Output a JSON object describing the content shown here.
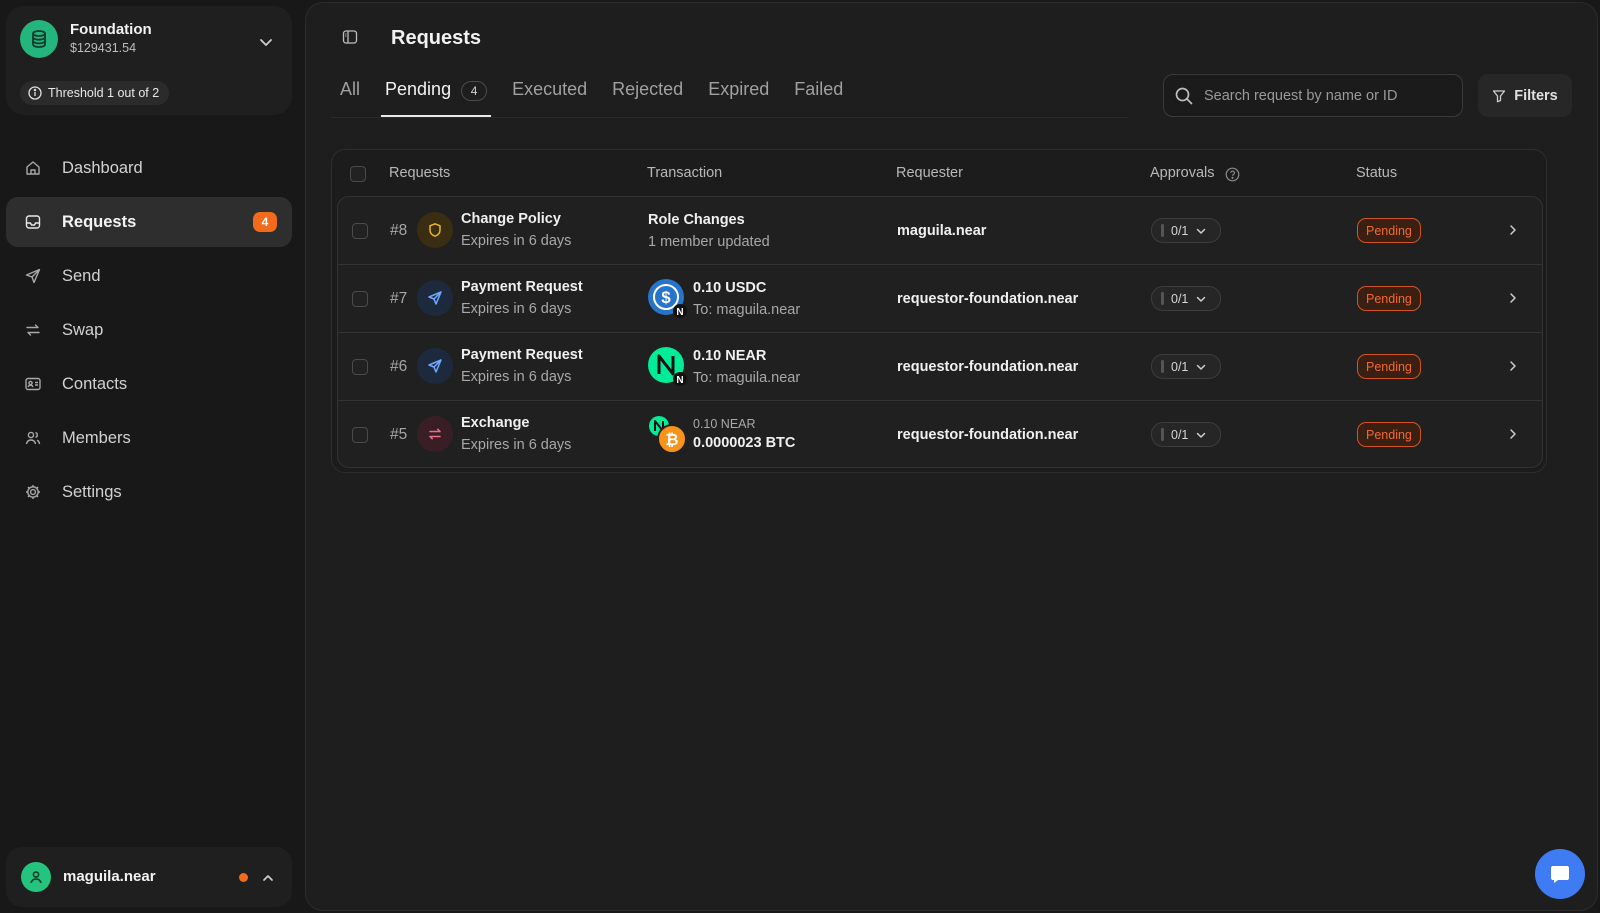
{
  "workspace": {
    "name": "Foundation",
    "balance": "$129431.54",
    "threshold": "Threshold 1 out of 2"
  },
  "nav": {
    "items": [
      {
        "label": "Dashboard",
        "icon": "home-icon"
      },
      {
        "label": "Requests",
        "icon": "inbox-icon",
        "badge": "4",
        "active": true
      },
      {
        "label": "Send",
        "icon": "send-icon"
      },
      {
        "label": "Swap",
        "icon": "swap-icon"
      },
      {
        "label": "Contacts",
        "icon": "contacts-icon"
      },
      {
        "label": "Members",
        "icon": "members-icon"
      },
      {
        "label": "Settings",
        "icon": "gear-icon"
      }
    ]
  },
  "user": {
    "name": "maguila.near"
  },
  "header": {
    "title": "Requests"
  },
  "tabs": [
    {
      "label": "All"
    },
    {
      "label": "Pending",
      "count": "4",
      "active": true
    },
    {
      "label": "Executed"
    },
    {
      "label": "Rejected"
    },
    {
      "label": "Expired"
    },
    {
      "label": "Failed"
    }
  ],
  "search": {
    "placeholder": "Search request by name or ID"
  },
  "filters": {
    "label": "Filters"
  },
  "table": {
    "columns": [
      "Requests",
      "Transaction",
      "Requester",
      "Approvals",
      "Status"
    ],
    "rows": [
      {
        "id": "#8",
        "title": "Change Policy",
        "expires": "Expires in 6 days",
        "type_icon": "shield-icon",
        "tx_title": "Role Changes",
        "tx_sub": "1 member updated",
        "requester": "maguila.near",
        "approvals": "0/1",
        "status": "Pending"
      },
      {
        "id": "#7",
        "title": "Payment Request",
        "expires": "Expires in 6 days",
        "type_icon": "send-icon",
        "token": "usdc-icon",
        "amount": "0.10 USDC",
        "to": "To: maguila.near",
        "requester": "requestor-foundation.near",
        "approvals": "0/1",
        "status": "Pending"
      },
      {
        "id": "#6",
        "title": "Payment Request",
        "expires": "Expires in 6 days",
        "type_icon": "send-icon",
        "token": "near-icon",
        "amount": "0.10 NEAR",
        "to": "To: maguila.near",
        "requester": "requestor-foundation.near",
        "approvals": "0/1",
        "status": "Pending"
      },
      {
        "id": "#5",
        "title": "Exchange",
        "expires": "Expires in 6 days",
        "type_icon": "swap-icon",
        "from_amount": "0.10 NEAR",
        "to_amount": "0.0000023 BTC",
        "requester": "requestor-foundation.near",
        "approvals": "0/1",
        "status": "Pending"
      }
    ]
  },
  "colors": {
    "accent_orange": "#f36a1d",
    "brand_green": "#24b47e",
    "chat_blue": "#3f7cf4",
    "pending": "#f06a2e"
  }
}
